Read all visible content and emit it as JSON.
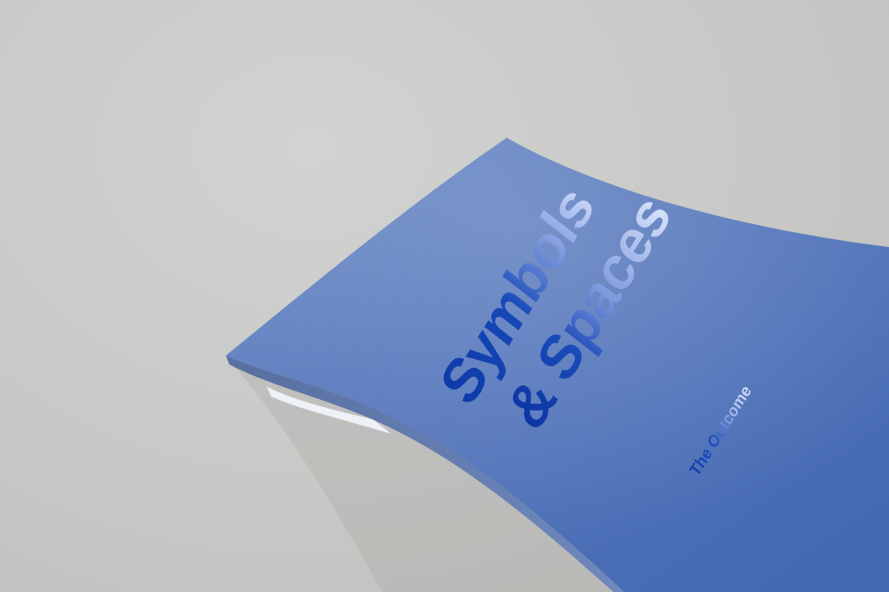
{
  "cover": {
    "title_line1": "Symbols",
    "title_line2": "& Spaces",
    "subtitle": "The Outcome"
  },
  "colors": {
    "background": "#c9c9c7",
    "cover_blue": "#4f74b9",
    "foil_blue": "#0d3aa8",
    "foil_silver": "#c8d6f7"
  }
}
